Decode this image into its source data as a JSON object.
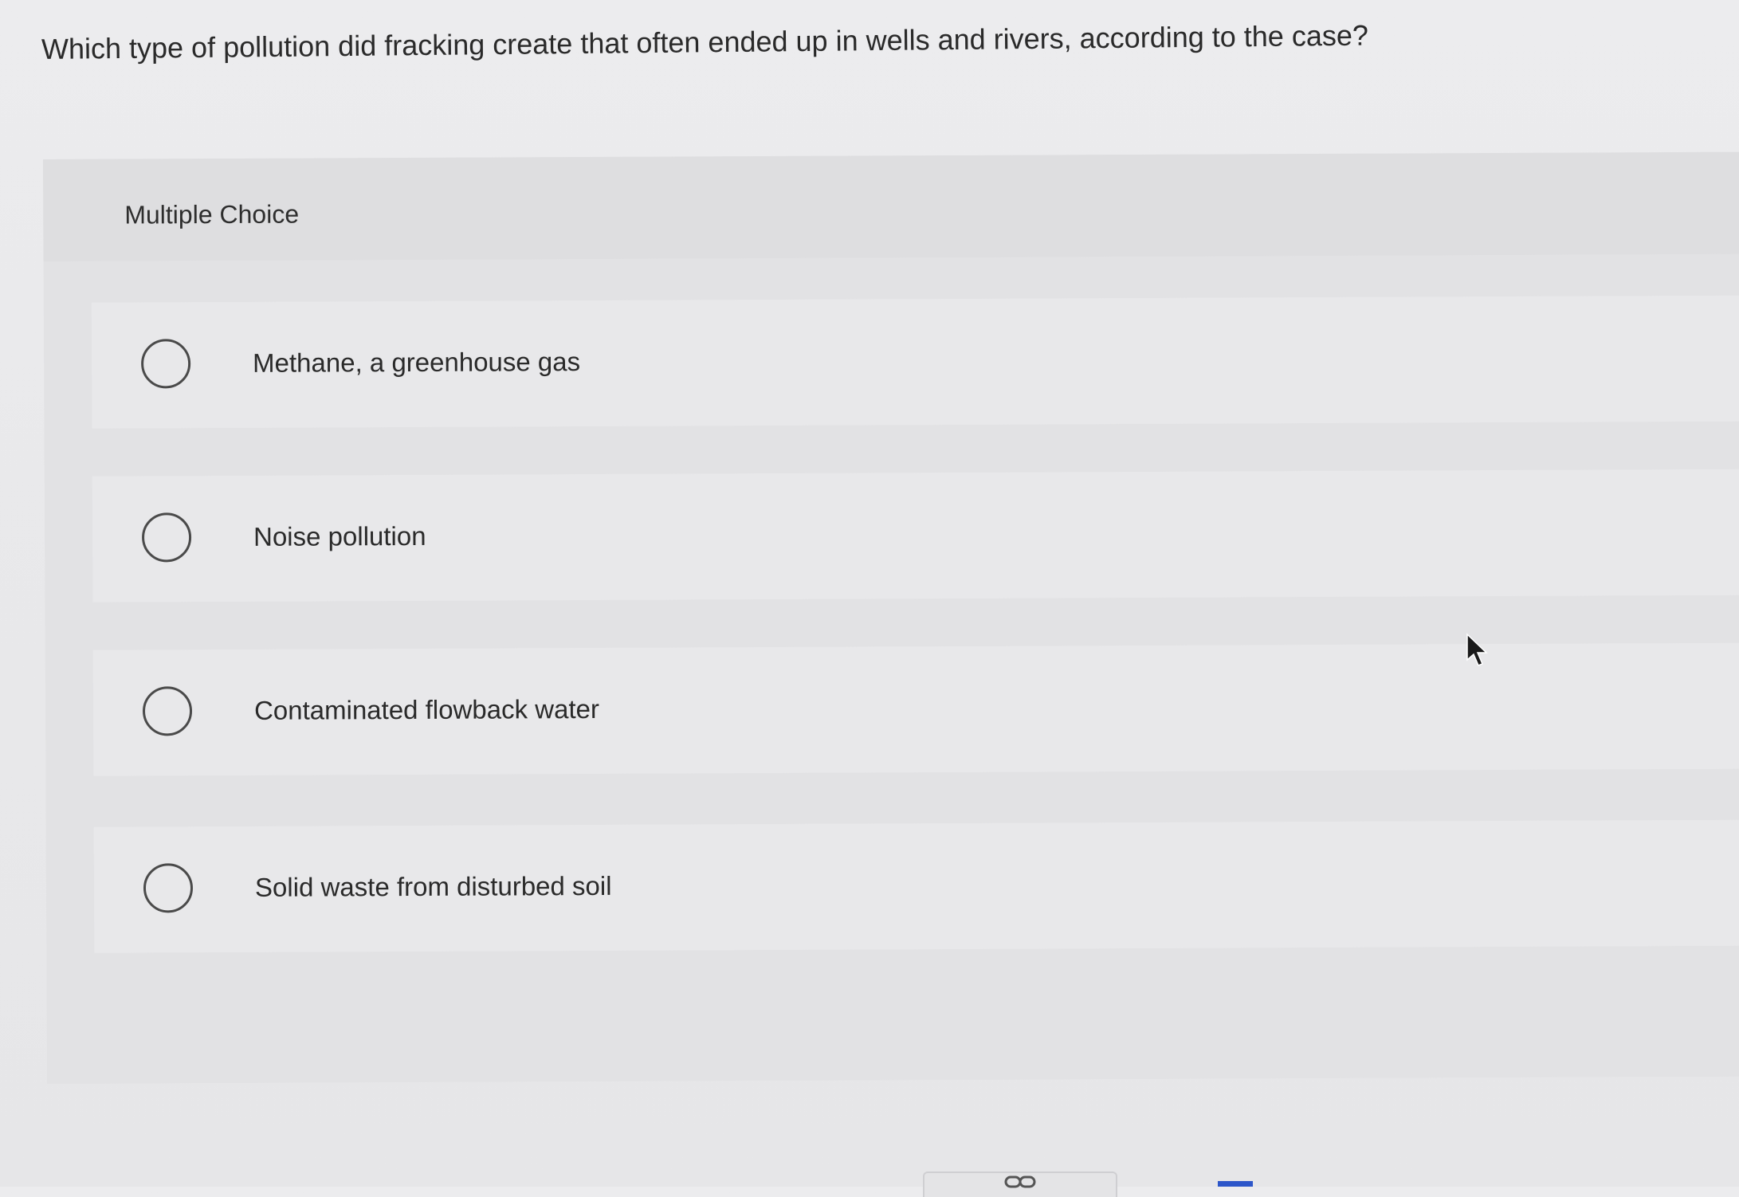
{
  "question": {
    "text": "Which type of pollution did fracking create that often ended up in wells and rivers, according to the case?"
  },
  "panel": {
    "title": "Multiple Choice"
  },
  "options": [
    {
      "label": "Methane, a greenhouse gas",
      "selected": false
    },
    {
      "label": "Noise pollution",
      "selected": false
    },
    {
      "label": "Contaminated flowback water",
      "selected": false
    },
    {
      "label": "Solid waste from disturbed soil",
      "selected": false
    }
  ],
  "icons": {
    "radio": "radio-unchecked-icon",
    "cursor": "mouse-pointer-icon",
    "link": "link-icon"
  },
  "colors": {
    "background": "#e9e9eb",
    "panel": "#e2e2e4",
    "text": "#2a2a2a",
    "radio_border": "#4a4a4a"
  }
}
